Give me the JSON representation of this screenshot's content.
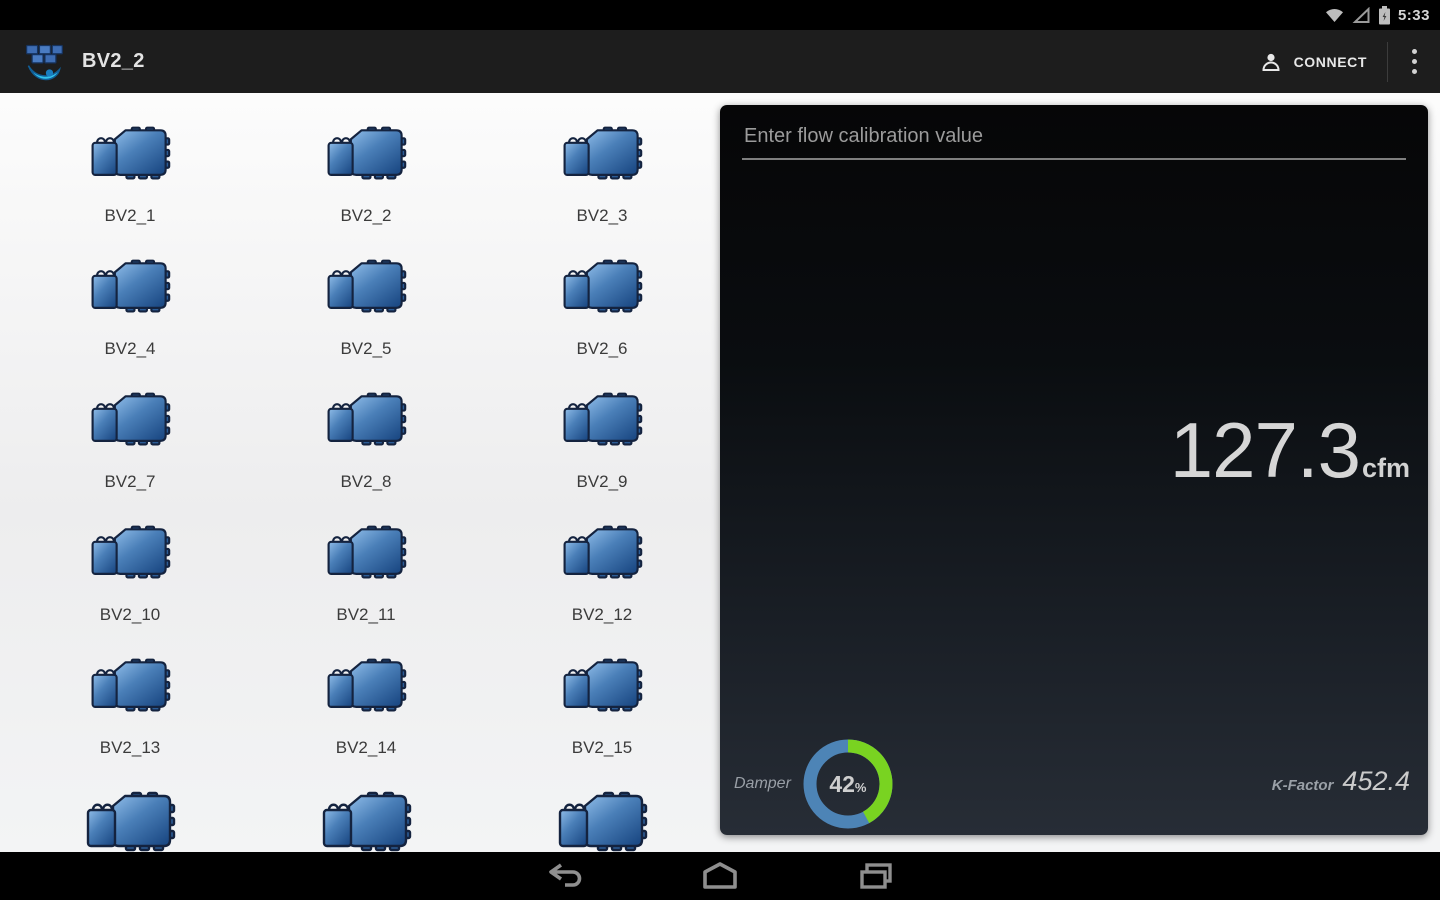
{
  "status_bar": {
    "time": "5:33",
    "icons": [
      "wifi-icon",
      "signal-icon",
      "battery-icon"
    ]
  },
  "app_bar": {
    "title": "BV2_2",
    "connect_label": "CONNECT",
    "icons": [
      "app-logo",
      "person-icon",
      "overflow-menu-icon"
    ]
  },
  "device_grid": {
    "devices": [
      "BV2_1",
      "BV2_2",
      "BV2_3",
      "BV2_4",
      "BV2_5",
      "BV2_6",
      "BV2_7",
      "BV2_8",
      "BV2_9",
      "BV2_10",
      "BV2_11",
      "BV2_12",
      "BV2_13",
      "BV2_14",
      "BV2_15"
    ],
    "partial_icons": 3
  },
  "calibration_panel": {
    "input_placeholder": "Enter flow calibration value",
    "input_value": "",
    "flow_value": "127.3",
    "flow_unit": "cfm",
    "damper_label": "Damper",
    "damper_percent": 42,
    "damper_percent_text": "42",
    "percent_sign": "%",
    "kfactor_label": "K-Factor",
    "kfactor_value": "452.4",
    "colors": {
      "damper_green": "#79d321",
      "damper_blue": "#4d84b6"
    }
  },
  "nav_bar": {
    "icons": [
      "back-icon",
      "home-icon",
      "recents-icon"
    ]
  }
}
